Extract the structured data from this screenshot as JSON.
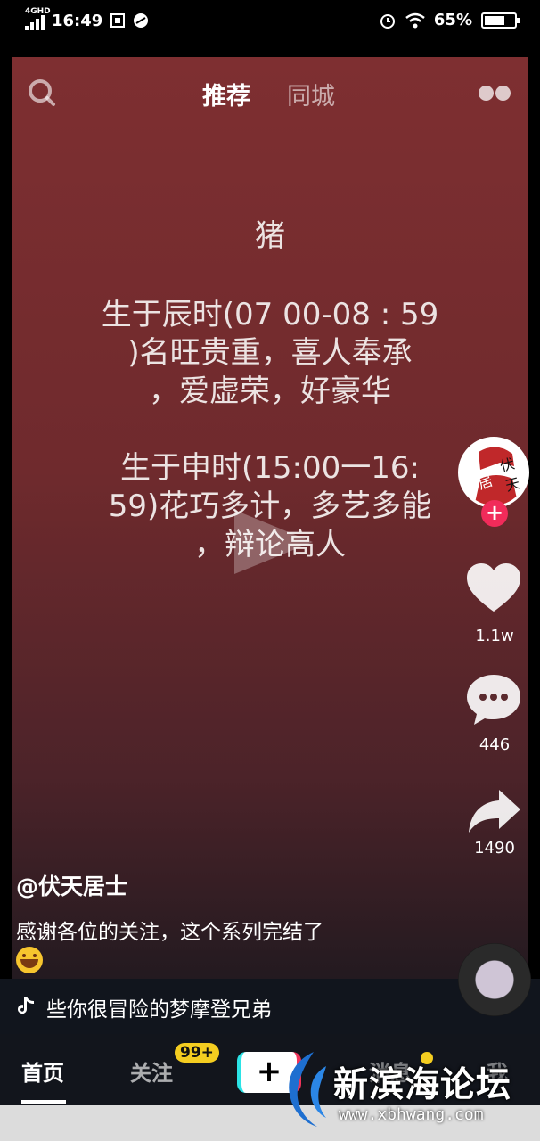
{
  "status_bar": {
    "network": "4GHD",
    "time": "16:49",
    "battery_pct": "65%"
  },
  "top_nav": {
    "tab_recommend": "推荐",
    "tab_local": "同城"
  },
  "video": {
    "title": "猪",
    "paragraph1": [
      "生于辰时(07 00-08 : 59",
      ")名旺贵重，喜人奉承",
      "，爱虚荣，好豪华"
    ],
    "paragraph2": [
      "生于申时(15:00一16:",
      "59)花巧多计，多艺多能",
      "，辩论高人"
    ],
    "author": "@伏天居士",
    "description": "感谢各位的关注，这个系列完结了",
    "avatar_text": "伏天居士"
  },
  "rail": {
    "likes": "1.1w",
    "comments": "446",
    "shares": "1490"
  },
  "music": {
    "text": "些你很冒险的梦摩登兄弟"
  },
  "tabbar": {
    "home": "首页",
    "follow": "关注",
    "follow_badge": "99+",
    "plus": "+",
    "messages": "消息",
    "me": "我"
  },
  "watermark": {
    "name": "新滨海论坛",
    "url": "www.xbhwang.com"
  },
  "colors": {
    "like_accent": "#f12b5a",
    "badge": "#f4cd20"
  }
}
